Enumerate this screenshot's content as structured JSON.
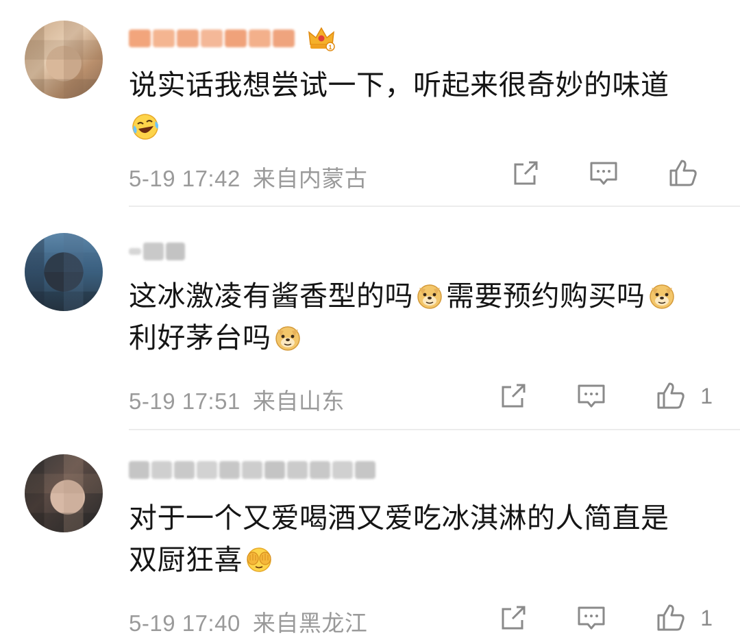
{
  "comments": [
    {
      "content_line1": "说实话我想尝试一下，听起来很奇妙的味道",
      "time": "5-19 17:42",
      "location": "来自内蒙古",
      "likes": "",
      "emoji": "laugh-cry-icon"
    },
    {
      "content_line1": "这冰激凌有酱香型的吗",
      "content_part2": "需要预约购买吗",
      "content_line2": "利好茅台吗",
      "time": "5-19 17:51",
      "location": "来自山东",
      "likes": "1",
      "emoji": "doge-icon"
    },
    {
      "content_line1": "对于一个又爱喝酒又爱吃冰淇淋的人简直是",
      "content_line2": "双厨狂喜",
      "time": "5-19 17:40",
      "location": "来自黑龙江",
      "likes": "1",
      "emoji": "cover-face-icon"
    }
  ],
  "colors": {
    "meta": "#9a9a9a",
    "divider": "#ececec",
    "text": "#151515",
    "vip_name": "#e8956a"
  }
}
